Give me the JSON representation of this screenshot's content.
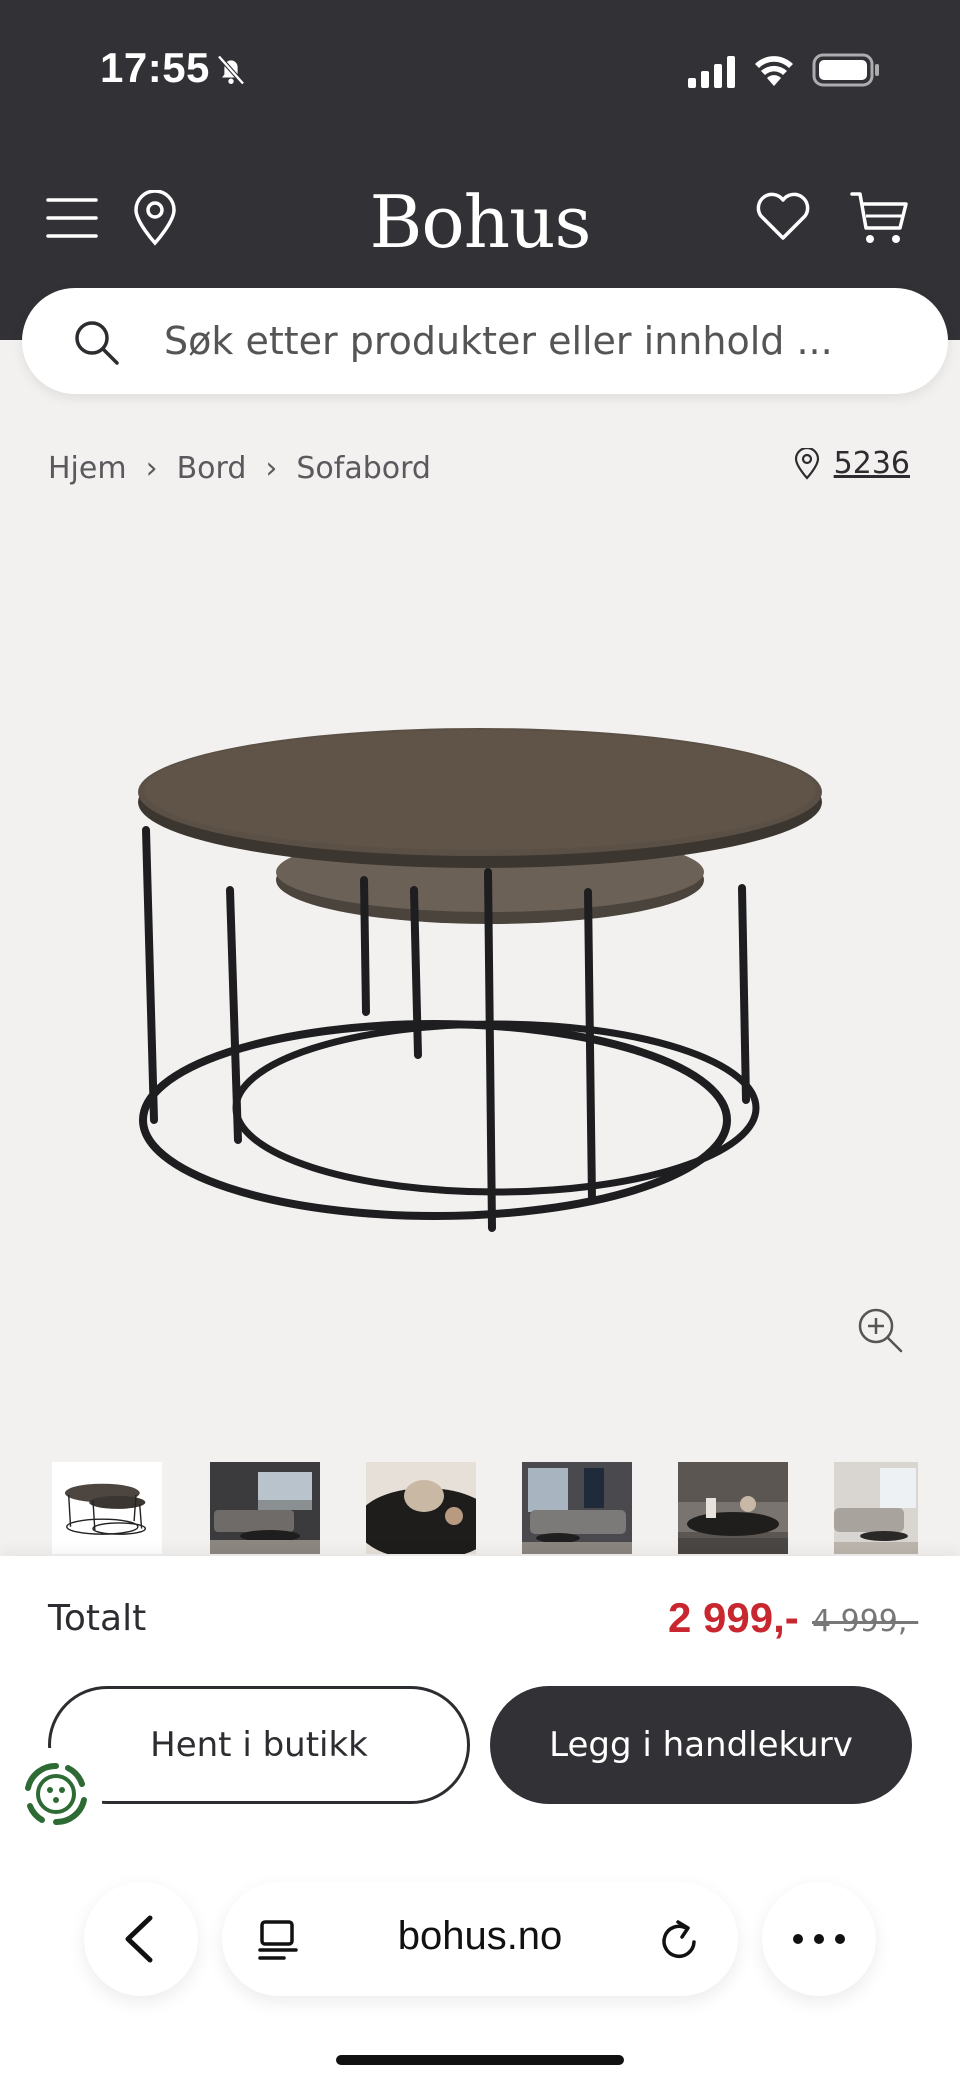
{
  "status_bar": {
    "time": "17:55"
  },
  "header": {
    "brand": "Bohus"
  },
  "search": {
    "placeholder": "Søk etter produkter eller innhold ..."
  },
  "breadcrumb": {
    "items": [
      "Hjem",
      "Bord",
      "Sofabord"
    ],
    "separator": "›"
  },
  "store": {
    "number": "5236"
  },
  "product": {
    "thumbnail_count": 6,
    "total_label": "Totalt",
    "price_now": "2 999,-",
    "price_old": "4 999,-"
  },
  "actions": {
    "pickup": "Hent i butikk",
    "add_to_cart": "Legg i handlekurv"
  },
  "browser": {
    "url": "bohus.no"
  },
  "colors": {
    "header_bg": "#323136",
    "accent_price": "#c8272f",
    "page_bg": "#f3f1ef"
  }
}
